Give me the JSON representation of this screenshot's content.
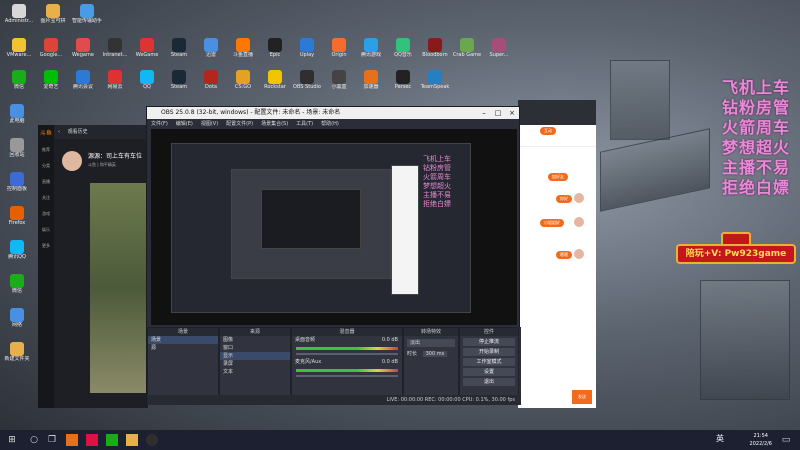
{
  "desktop": {
    "top_icons": [
      {
        "label": "Administr...",
        "color": "#d8d8d8"
      },
      {
        "label": "图片宝可拼",
        "color": "#e7b04a"
      },
      {
        "label": "智能传输助手",
        "color": "#4a9be7"
      }
    ],
    "row1_icons": [
      {
        "label": "VMware...",
        "color": "#f1c232"
      },
      {
        "label": "Google...",
        "color": "#db4437"
      },
      {
        "label": "Wegame",
        "color": "#e24b4b"
      },
      {
        "label": "Intranet...",
        "color": "#333"
      },
      {
        "label": "WeGame",
        "color": "#dd3333"
      },
      {
        "label": "Steam",
        "color": "#1b2838"
      },
      {
        "label": "迅雷",
        "color": "#4a90e2"
      },
      {
        "label": "斗鱼直播",
        "color": "#ff7700"
      },
      {
        "label": "Epic",
        "color": "#222"
      },
      {
        "label": "Uplay",
        "color": "#2b7bd6"
      },
      {
        "label": "Origin",
        "color": "#f56c2d"
      },
      {
        "label": "腾讯游戏",
        "color": "#2aa0ea"
      },
      {
        "label": "QQ音乐",
        "color": "#31c27c"
      },
      {
        "label": "Bloodborn",
        "color": "#8a1a1a"
      },
      {
        "label": "Crab Game",
        "color": "#6aa84f"
      },
      {
        "label": "Super...",
        "color": "#a64d79"
      }
    ],
    "row2_icons": [
      {
        "label": "微信",
        "color": "#1aad19"
      },
      {
        "label": "爱奇艺",
        "color": "#00be06"
      },
      {
        "label": "腾讯会议",
        "color": "#2b7bd6"
      },
      {
        "label": "网易云",
        "color": "#e03131"
      },
      {
        "label": "QQ",
        "color": "#12b7f5"
      },
      {
        "label": "Steam",
        "color": "#1b2838"
      },
      {
        "label": "Dota",
        "color": "#b3261e"
      },
      {
        "label": "CS:GO",
        "color": "#e6a023"
      },
      {
        "label": "Rockstar",
        "color": "#f2c500"
      },
      {
        "label": "OBS Studio",
        "color": "#302e31"
      },
      {
        "label": "小黑盒",
        "color": "#444"
      },
      {
        "label": "加速器",
        "color": "#e7711b"
      },
      {
        "label": "Parsec",
        "color": "#222"
      },
      {
        "label": "TeamSpeak",
        "color": "#2580c3"
      }
    ],
    "left_column": [
      "此电脑",
      "回收站",
      "控制面板",
      "Firefox",
      "腾讯QQ",
      "微信",
      "网络",
      "新建文件夹"
    ]
  },
  "douyu": {
    "logo": "斗鱼",
    "nav_back": "‹",
    "nav_title": "观看历史",
    "sidebar": [
      "推荐",
      "分类",
      "直播",
      "关注",
      "游戏",
      "娱乐",
      "更多"
    ],
    "streamer_title": "源源：司上车有车位",
    "streamer_sub": "斗鱼 | 和平精英"
  },
  "obs": {
    "title": "OBS 25.0.8 (32-bit, windows) - 配置文件: 未命名 - 场景: 未命名",
    "menu": [
      "文件(F)",
      "编辑(E)",
      "视图(V)",
      "配置文件(P)",
      "场景集合(S)",
      "工具(T)",
      "帮助(H)"
    ],
    "docks": {
      "scenes_header": "场景",
      "scenes": [
        "场景",
        "源"
      ],
      "sources_header": "来源",
      "sources": [
        "图像",
        "窗口",
        "显示",
        "录屏",
        "文本"
      ],
      "mixer_header": "混音器",
      "mixer": [
        {
          "name": "桌面音频",
          "value": "0.0 dB"
        },
        {
          "name": "麦克风/Aux",
          "value": "0.0 dB"
        }
      ],
      "transitions_header": "转场特效",
      "transition_value": "淡出",
      "duration_label": "时长",
      "duration_value": "300 ms",
      "controls_header": "控件",
      "controls": [
        "停止推流",
        "开始录制",
        "工作室模式",
        "设置",
        "退出"
      ]
    },
    "status": "LIVE: 00:00:00   REC: 00:00:00   CPU: 0.1%, 30.00 fps"
  },
  "chat": {
    "top_tag": "互动",
    "tag2": "加好友",
    "messages": [
      "你好",
      "在吗",
      "小姐姐好",
      "嗯嗯"
    ],
    "send": "发送"
  },
  "overlay": {
    "lines": [
      "飞机上车",
      "钻粉房管",
      "火箭周车",
      "梦想超火",
      "主播不易",
      "拒绝白嫖"
    ],
    "banner": "陪玩+V: Pw923game"
  },
  "taskbar": {
    "start_icon": "windows-logo",
    "lang": "英",
    "time": "21:54",
    "date": "2022/2/6"
  }
}
